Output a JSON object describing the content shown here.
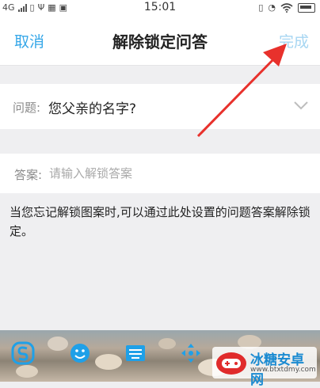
{
  "status_bar": {
    "network": "4G",
    "time": "15:01",
    "icons": [
      "signal-icon",
      "usb-icon",
      "keyboard-icon",
      "app-icon",
      "vibrate-icon",
      "alarm-icon",
      "wifi-icon",
      "battery-icon"
    ]
  },
  "nav": {
    "cancel_label": "取消",
    "title": "解除锁定问答",
    "done_label": "完成"
  },
  "question": {
    "label": "问题:",
    "value": "您父亲的名字?"
  },
  "answer": {
    "label": "答案:",
    "placeholder": "请输入解锁答案",
    "value": ""
  },
  "hint": "当您忘记解锁图案时,可以通过此处设置的问题答案解除锁定。",
  "keyboard_toolbar": {
    "icons": [
      "sogou-logo-icon",
      "emoji-icon",
      "keyboard-switch-icon",
      "cursor-move-icon"
    ]
  },
  "watermark": {
    "name": "冰糖安卓网",
    "url": "www.btxtdmy.com"
  },
  "colors": {
    "accent": "#36a7e8",
    "done_disabled": "#a7d6f2",
    "annotation_arrow": "#e8312c"
  }
}
